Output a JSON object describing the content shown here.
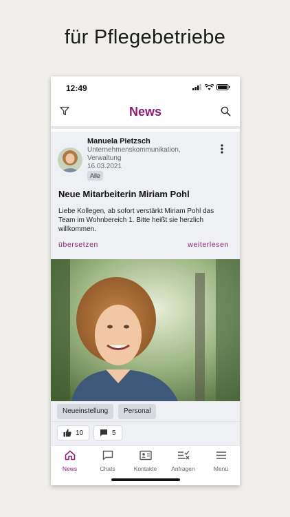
{
  "promo": {
    "headline": "für Pflegebetriebe"
  },
  "status": {
    "time": "12:49"
  },
  "appbar": {
    "title": "News"
  },
  "post": {
    "author": "Manuela Pietzsch",
    "meta_line1": "Unternehmenskommunikation,",
    "meta_line2": "Verwaltung",
    "date": "16.03.2021",
    "audience_badge": "Alle",
    "title": "Neue Mitarbeiterin Miriam Pohl",
    "body": "Liebe Kollegen, ab sofort verstärkt Miriam Pohl das Team im Wohnbereich 1. Bitte heißt sie herzlich willkommen.",
    "translate_label": "übersetzen",
    "read_more_label": "weiterlesen",
    "tags": [
      "Neueinstellung",
      "Personal"
    ],
    "likes": "10",
    "comments": "5"
  },
  "tabs": [
    {
      "label": "News",
      "icon": "home-icon",
      "active": true
    },
    {
      "label": "Chats",
      "icon": "chat-icon",
      "active": false
    },
    {
      "label": "Kontakte",
      "icon": "contact-card-icon",
      "active": false
    },
    {
      "label": "Anfragen",
      "icon": "requests-icon",
      "active": false
    },
    {
      "label": "Menü",
      "icon": "menu-icon",
      "active": false
    }
  ],
  "colors": {
    "accent": "#8c1d74",
    "card_bg": "#eef0f3",
    "page_bg": "#f1efec"
  }
}
